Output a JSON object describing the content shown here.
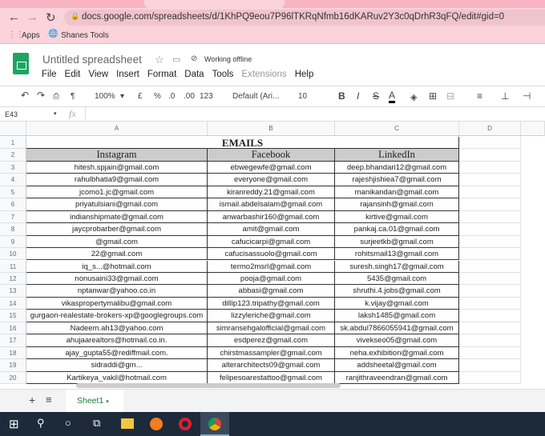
{
  "browser": {
    "url": "docs.google.com/spreadsheets/d/1KhPQ9eou7P96lTKRqNfmb16dKARuv2Y3c0qDrhR3qFQ/edit#gid=0",
    "bookmarks": [
      "Apps",
      "Shanes Tools"
    ]
  },
  "doc": {
    "title": "Untitled spreadsheet",
    "status": "Working offline",
    "menu": [
      "File",
      "Edit",
      "View",
      "Insert",
      "Format",
      "Data",
      "Tools",
      "Extensions",
      "Help"
    ]
  },
  "toolbar": {
    "zoom": "100%",
    "currency": "£",
    "percent": "%",
    "dec_less": ".0",
    "dec_more": ".00",
    "format": "123",
    "font": "Default (Ari...",
    "size": "10",
    "bold": "B",
    "italic": "I",
    "strike": "S",
    "color": "A"
  },
  "formula": {
    "cell_ref": "E43",
    "fx": "fx"
  },
  "columns": [
    "A",
    "B",
    "C",
    "D"
  ],
  "sheet": {
    "title": "EMAILS",
    "headers": [
      "Instagram",
      "Facebook",
      "LinkedIn"
    ],
    "rows": [
      [
        "hitesh.spjain@gmail.com",
        "ebwegewfe@gmail.com",
        "deep.bhandari12@gmail.com"
      ],
      [
        "rahulbhatia9@gmail.com",
        "everyone@gmail.com",
        "rajeshjishiea7@gmail.com"
      ],
      [
        "jcomo1.jc@gmail.com",
        "kiranreddy.21@gmail.com",
        "manikandan@gmail.com"
      ],
      [
        "priyatulsiani@gmail.com",
        "ismail.abdelsalam@gmail.com",
        "rajansinh@gmail.com"
      ],
      [
        "indianshipmate@gmail.com",
        "anwarbashir160@gmail.com",
        "kirtive@gmail.com"
      ],
      [
        "jaycprobarber@gmail.com",
        "amit@gmail.com",
        "pankaj.ca.01@gmail.com"
      ],
      [
        "@gmail.com",
        "cafucicarpi@gmail.com",
        "surjeetkb@gmail.com"
      ],
      [
        "22@gmail.com",
        "cafucisassuolo@gmail.com",
        "rohitsmail13@gmail.com"
      ],
      [
        "iq_s...@hotmail.com",
        "termo2msrl@gmail.com",
        "suresh.singh17@gmail.com"
      ],
      [
        "nonusaini33@gmail.com",
        "pooja@gmail.com",
        "5435@gmail.com"
      ],
      [
        "nptanwar@yahoo.co.in",
        "abbasi@gmail.com",
        "shruthi.4.jobs@gmail.com"
      ],
      [
        "vikaspropertymalibu@gmail.com",
        "dillip123.tripathy@gmail.com",
        "k.vijay@gmail.com"
      ],
      [
        "gurgaon-realestate-brokers-xp@googlegroups.com",
        "lizzyleriche@gmail.com",
        "laksh1485@gmail.com"
      ],
      [
        "Nadeem.ah13@yahoo.com",
        "simransehgalofficial@gmail.com",
        "sk.abdul7866055941@gmail.com"
      ],
      [
        "ahujaarealtors@hotmail.co.in.",
        "esdperez@gmail.com",
        "vivekseo05@gmail.com"
      ],
      [
        "ajay_gupta55@rediffmail.com.",
        "chirstmassampler@gmail.com",
        "neha.exhibition@gmail.com"
      ],
      [
        "sidraddi@gm...",
        "alterarchitects09@gmail.com",
        "addsheetal@gmail.com"
      ],
      [
        "Kartikeya_vakil@hotmail.com",
        "felipesoarestattoo@gmail.com",
        "ranjithraveendran@gmail.com"
      ]
    ]
  },
  "sheet_tab": "Sheet1"
}
